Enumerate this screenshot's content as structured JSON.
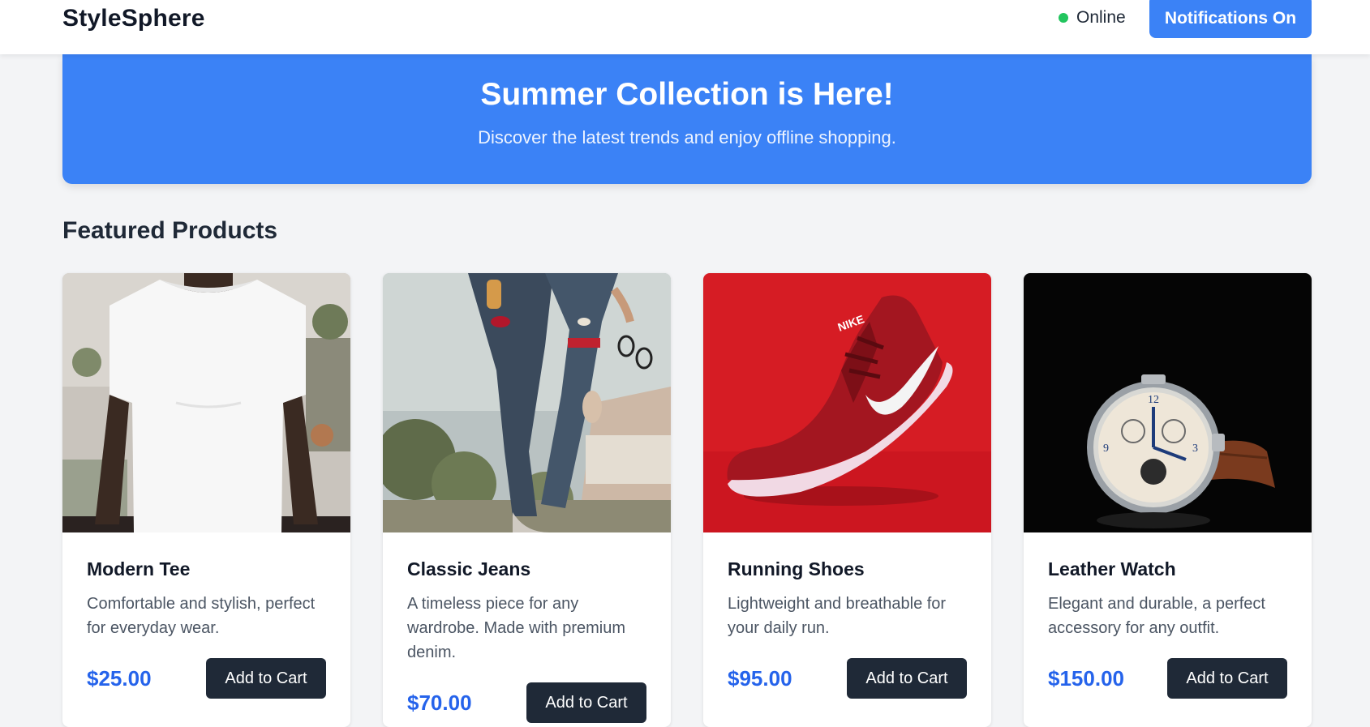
{
  "header": {
    "brand": "StyleSphere",
    "status_label": "Online",
    "notifications_label": "Notifications On"
  },
  "hero": {
    "title": "Summer Collection is Here!",
    "subtitle": "Discover the latest trends and enjoy offline shopping."
  },
  "section": {
    "title": "Featured Products"
  },
  "products": [
    {
      "name": "Modern Tee",
      "description": "Comfortable and stylish, perfect for everyday wear.",
      "price": "$25.00",
      "cta": "Add to Cart"
    },
    {
      "name": "Classic Jeans",
      "description": "A timeless piece for any wardrobe. Made with premium denim.",
      "price": "$70.00",
      "cta": "Add to Cart"
    },
    {
      "name": "Running Shoes",
      "description": "Lightweight and breathable for your daily run.",
      "price": "$95.00",
      "cta": "Add to Cart"
    },
    {
      "name": "Leather Watch",
      "description": "Elegant and durable, a perfect accessory for any outfit.",
      "price": "$150.00",
      "cta": "Add to Cart"
    }
  ],
  "colors": {
    "accent": "#3b82f6",
    "price": "#2563eb",
    "button_dark": "#1f2937",
    "status_online": "#22c55e",
    "background": "#f3f4f6"
  }
}
